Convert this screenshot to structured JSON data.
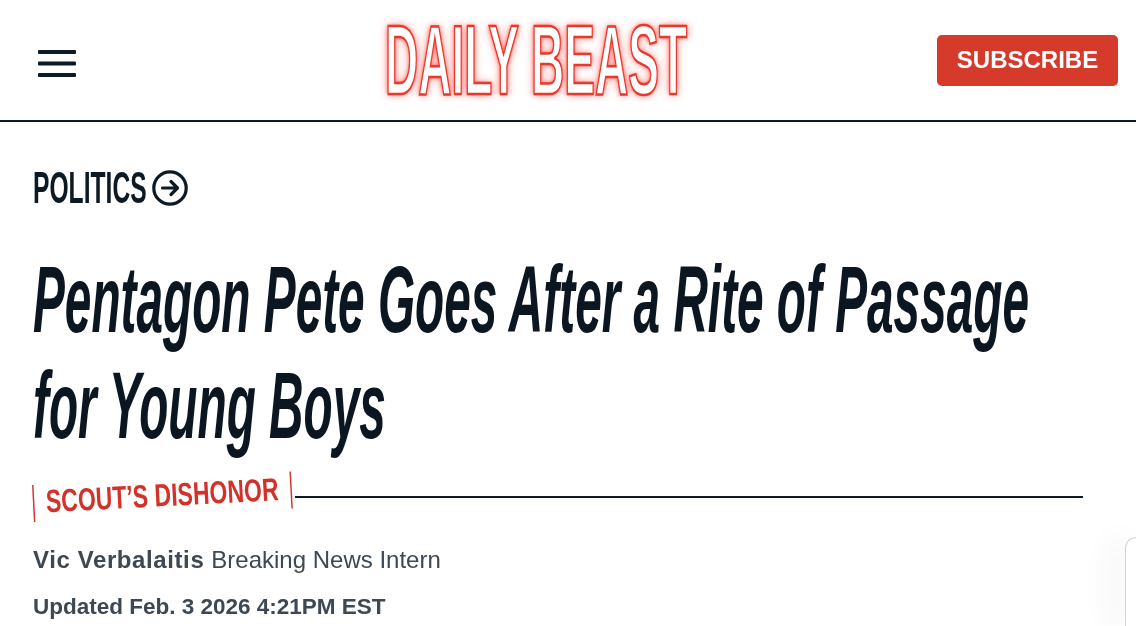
{
  "header": {
    "logo": "DAILY BEAST",
    "subscribe_button": "SUBSCRIBE"
  },
  "article": {
    "section": "POLITICS",
    "headline": "Pentagon Pete Goes After a Rite of Passage for Young Boys",
    "kicker": "SCOUT’S DISHONOR",
    "author": "Vic Verbalaitis",
    "author_role": "Breaking News Intern",
    "updated": "Updated Feb. 3 2026 4:21PM EST"
  }
}
